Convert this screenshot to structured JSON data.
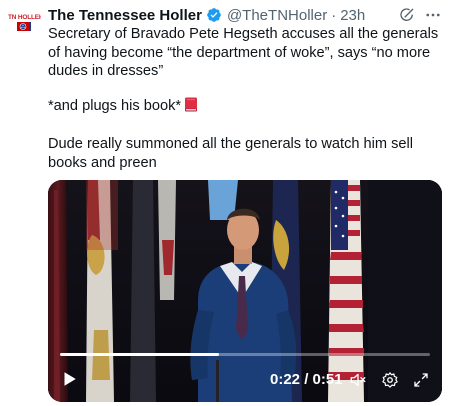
{
  "author": {
    "name": "The Tennessee Holler",
    "handle": "@TheTNHoller",
    "separator": "·",
    "time": "23h",
    "avatar_text": "TN HOLLER",
    "verified_color": "#1d9bf0"
  },
  "tweet": {
    "paragraph1": "Secretary of Bravado Pete Hegseth accuses all the generals of having become “the department of woke”, says “no more dudes in dresses”",
    "paragraph2": "*and plugs his book*",
    "paragraph2_emoji": "closed-book-icon",
    "paragraph3": "Dude really summoned all the generals to watch him sell books and preen"
  },
  "video": {
    "current_time": "0:22",
    "duration": "0:51",
    "time_display": "0:22 / 0:51",
    "progress_fraction": 0.43,
    "muted": true
  },
  "colors": {
    "text": "#0f1419",
    "secondary": "#536471",
    "accent": "#1d9bf0"
  },
  "icons": [
    "verified-badge-icon",
    "grok-icon",
    "more-icon",
    "play-icon",
    "volume-muted-icon",
    "settings-icon",
    "fullscreen-icon"
  ]
}
